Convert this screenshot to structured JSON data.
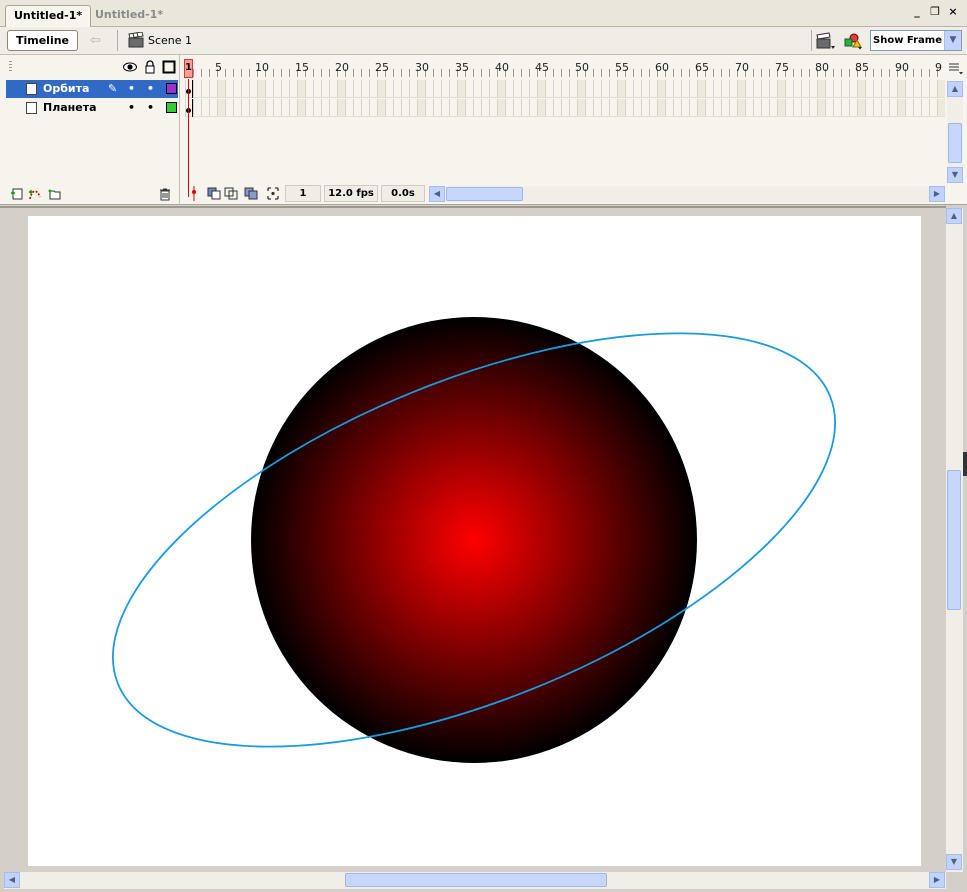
{
  "document_tabs": [
    {
      "label": "Untitled-1*",
      "active": true
    },
    {
      "label": "Untitled-1*",
      "active": false
    }
  ],
  "window_controls": {
    "minimize": "_",
    "restore": "❐",
    "close": "×"
  },
  "toolbar": {
    "timeline_label": "Timeline",
    "scene_label": "Scene 1",
    "zoom_value": "Show Frame"
  },
  "layers": [
    {
      "name": "Орбита",
      "color": "#9933cc",
      "selected": true
    },
    {
      "name": "Планета",
      "color": "#33cc33",
      "selected": false
    }
  ],
  "ruler": {
    "current_frame_marker": "1",
    "labels": [
      "5",
      "10",
      "15",
      "20",
      "25",
      "30",
      "35",
      "40",
      "45",
      "50",
      "55",
      "60",
      "65",
      "70",
      "75",
      "80",
      "85",
      "90",
      "9"
    ]
  },
  "status": {
    "current_frame": "1",
    "frame_rate": "12.0 fps",
    "elapsed_time": "0.0s"
  },
  "stage": {
    "background": "#ffffff",
    "planet": {
      "center_color": "#ff0000",
      "edge_color": "#000000"
    },
    "orbit": {
      "stroke_color": "#1a9be0"
    }
  },
  "colors": {
    "selection": "#316ac5",
    "scrollbar": "#c1d3fb",
    "playhead": "#dd0000"
  }
}
